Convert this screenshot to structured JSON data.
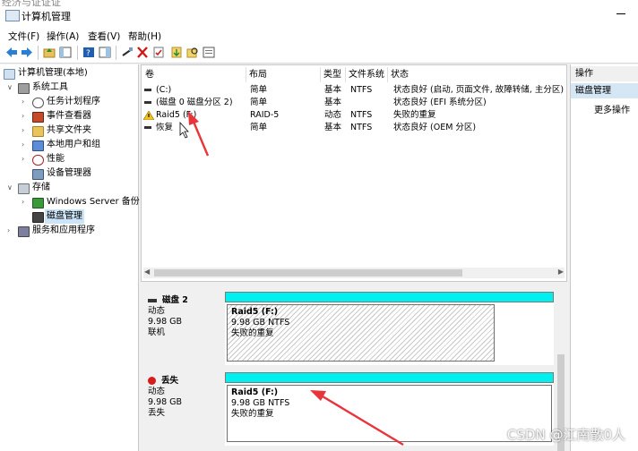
{
  "window": {
    "title": "计算机管理",
    "cut_text": "经济与证证证"
  },
  "menu": [
    "文件(F)",
    "操作(A)",
    "查看(V)",
    "帮助(H)"
  ],
  "tree": {
    "root": "计算机管理(本地)",
    "system_tools": "系统工具",
    "task_scheduler": "任务计划程序",
    "event_viewer": "事件查看器",
    "shared_folders": "共享文件夹",
    "local_users": "本地用户和组",
    "performance": "性能",
    "device_manager": "设备管理器",
    "storage": "存储",
    "windows_backup": "Windows Server 备份",
    "disk_management": "磁盘管理",
    "services_apps": "服务和应用程序"
  },
  "volume_list": {
    "headers": [
      "卷",
      "布局",
      "类型",
      "文件系统",
      "状态"
    ],
    "rows": [
      {
        "vol": "(C:)",
        "layout": "简单",
        "type": "基本",
        "fs": "NTFS",
        "status": "状态良好 (启动, 页面文件, 故障转储, 主分区)"
      },
      {
        "vol": "(磁盘 0 磁盘分区 2)",
        "layout": "简单",
        "type": "基本",
        "fs": "",
        "status": "状态良好 (EFI 系统分区)"
      },
      {
        "vol": "Raid5 (F:)",
        "layout": "RAID-5",
        "type": "动态",
        "fs": "NTFS",
        "status": "失败的重复"
      },
      {
        "vol": "恢复",
        "layout": "简单",
        "type": "基本",
        "fs": "NTFS",
        "status": "状态良好 (OEM 分区)"
      }
    ]
  },
  "disks": [
    {
      "name": "磁盘 2",
      "kind": "动态",
      "size": "9.98 GB",
      "state": "联机",
      "partition": {
        "title": "Raid5  (F:)",
        "size": "9.98 GB NTFS",
        "status": "失败的重复"
      }
    },
    {
      "name": "丢失",
      "kind": "动态",
      "size": "9.98 GB",
      "state": "丢失",
      "partition": {
        "title": "Raid5  (F:)",
        "size": "9.98 GB NTFS",
        "status": "失败的重复"
      }
    }
  ],
  "actions": {
    "header": "操作",
    "section": "磁盘管理",
    "more": "更多操作"
  },
  "watermark": "CSDN @江南散0人",
  "colors": {
    "accent_bar": "#00f0f0",
    "selection": "#cce4f7",
    "annotation_arrow": "#e8343a"
  }
}
